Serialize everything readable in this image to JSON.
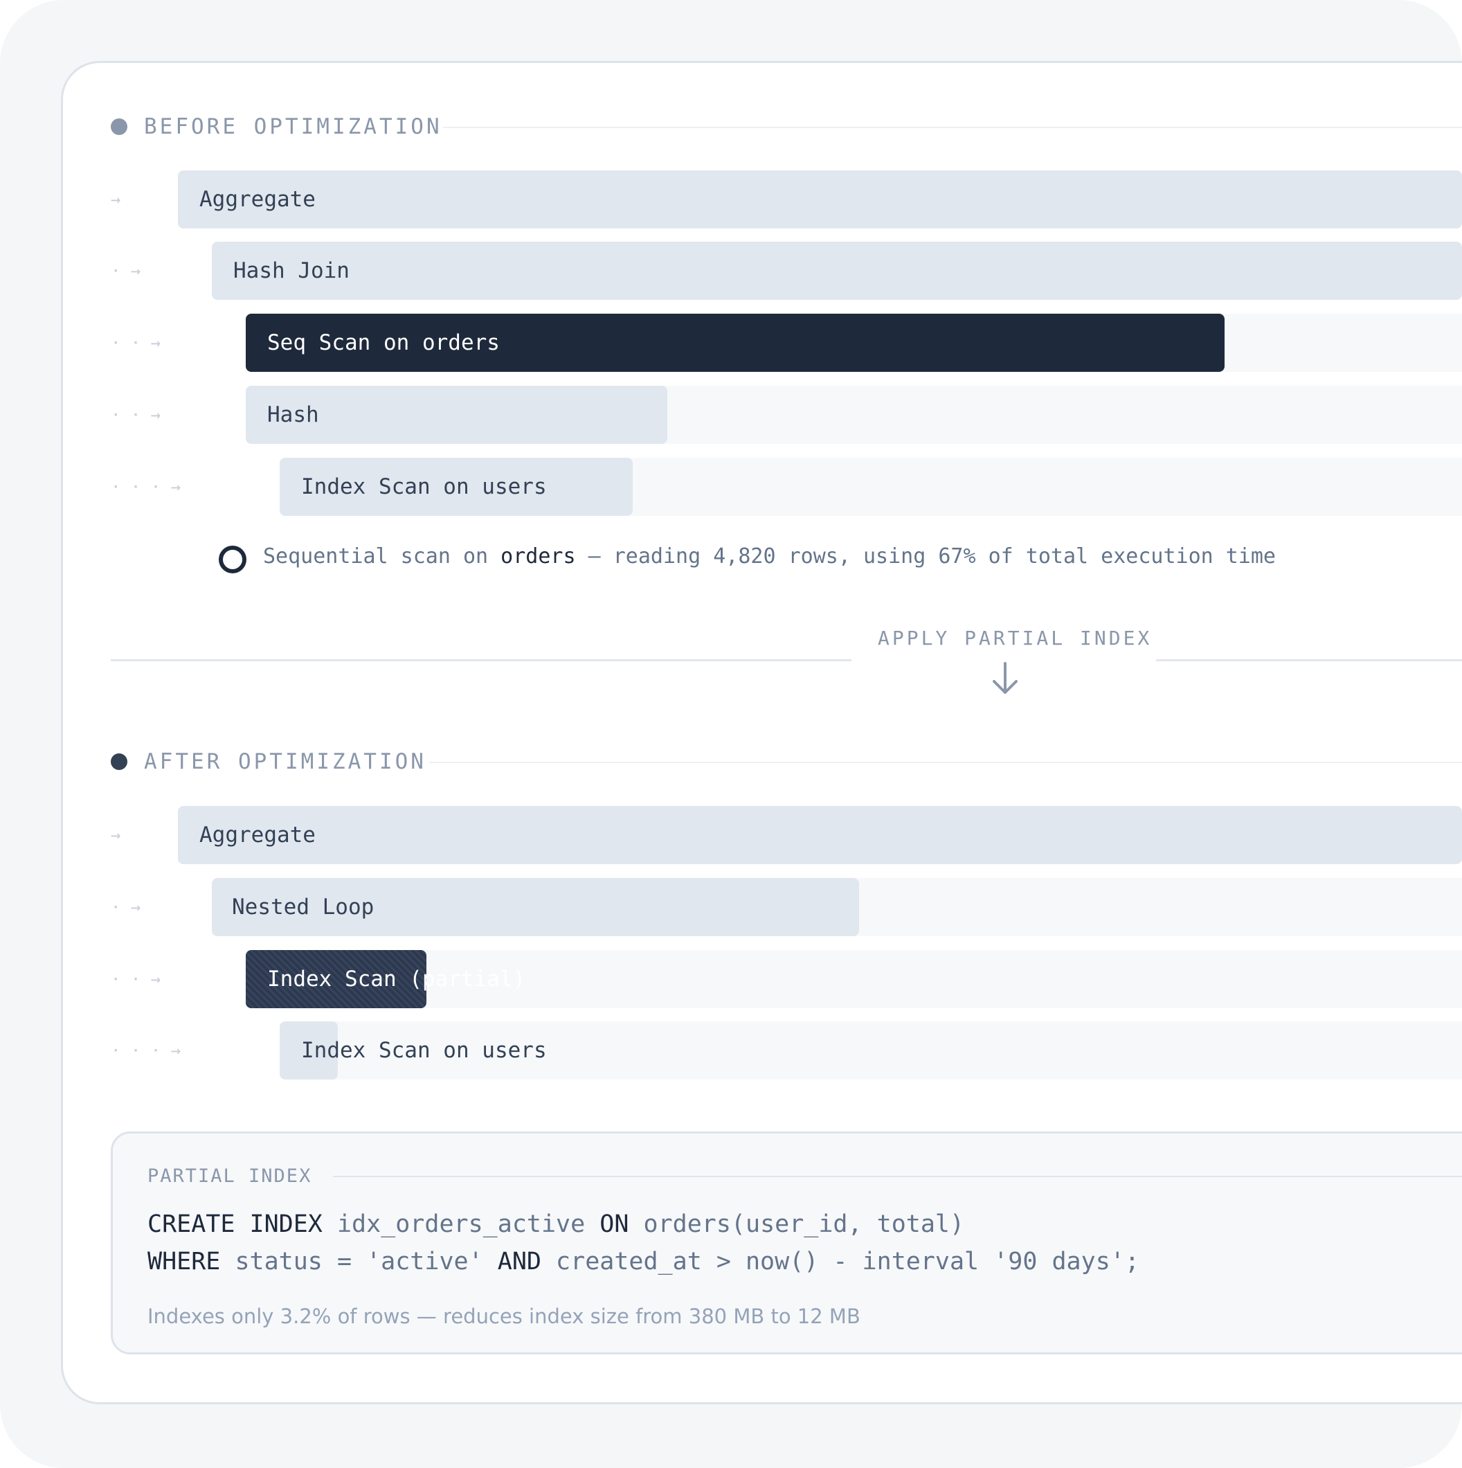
{
  "before": {
    "title": "BEFORE OPTIMIZATION",
    "rows": [
      {
        "guide": "→",
        "label": "Aggregate",
        "level": 0,
        "highlight": false
      },
      {
        "guide": "· →",
        "label": "Hash Join",
        "level": 1,
        "highlight": false
      },
      {
        "guide": "· · →",
        "label": "Seq Scan on orders",
        "level": 2,
        "highlight": true
      },
      {
        "guide": "· · →",
        "label": "Hash",
        "level": 2,
        "highlight": false
      },
      {
        "guide": "· · · →",
        "label": "Index Scan on users",
        "level": 3,
        "highlight": false
      }
    ],
    "note": {
      "prefix": "Sequential scan on",
      "table": "orders",
      "suffix": "— reading 4,820 rows, using 67% of total execution time"
    }
  },
  "divider": {
    "title": "APPLY PARTIAL INDEX",
    "icon": "arrow-down-icon"
  },
  "after": {
    "title": "AFTER OPTIMIZATION",
    "rows": [
      {
        "guide": "→",
        "label": "Aggregate",
        "level": 0,
        "highlight": false
      },
      {
        "guide": "· →",
        "label": "Nested Loop",
        "level": 1,
        "highlight": false
      },
      {
        "guide": "· · →",
        "label": "Index Scan (partial)",
        "level": 2,
        "highlight": true
      },
      {
        "guide": "· · · →",
        "label": "Index Scan on users",
        "level": 3,
        "highlight": false
      }
    ]
  },
  "partial_index": {
    "label": "PARTIAL INDEX",
    "line1": {
      "kw1": "CREATE INDEX",
      "name": "idx_orders_active",
      "kw2": "ON",
      "target": "orders(user_id, total)"
    },
    "line2": {
      "kw1": "WHERE",
      "cond1": "status = 'active'",
      "kw2": "AND",
      "cond2": "created_at > now() - interval '90 days';"
    },
    "caption": "Indexes only 3.2% of rows — reduces index size from 380 MB to 12 MB"
  },
  "colors": {
    "bar": "#e1e7ef",
    "bar_highlight": "#1e293b",
    "track": "#f7f8fa",
    "muted_text": "#8a97aa"
  }
}
